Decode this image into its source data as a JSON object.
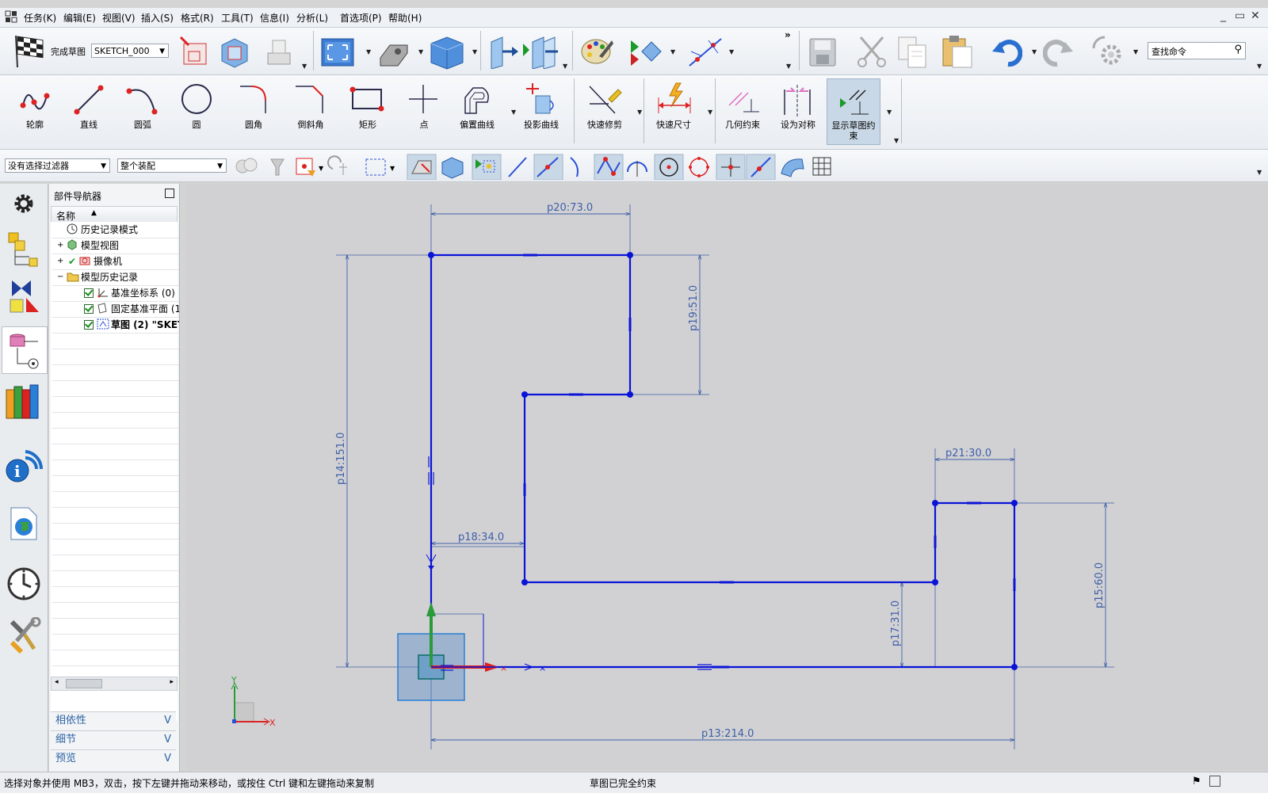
{
  "menu": {
    "items": [
      "任务(K)",
      "编辑(E)",
      "视图(V)",
      "插入(S)",
      "格式(R)",
      "工具(T)",
      "信息(I)",
      "分析(L)",
      "首选项(P)",
      "帮助(H)"
    ]
  },
  "toolbar_main": {
    "finish_sketch_label": "完成草图",
    "sketch_name": "SKETCH_000",
    "search_placeholder": "查找命令",
    "overflow_label": "»"
  },
  "sketch_tools": [
    {
      "label": "轮廓",
      "icon": "profile-icon"
    },
    {
      "label": "直线",
      "icon": "line-icon"
    },
    {
      "label": "圆弧",
      "icon": "arc-icon"
    },
    {
      "label": "圆",
      "icon": "circle-icon"
    },
    {
      "label": "圆角",
      "icon": "fillet-icon"
    },
    {
      "label": "倒斜角",
      "icon": "chamfer-icon"
    },
    {
      "label": "矩形",
      "icon": "rectangle-icon"
    },
    {
      "label": "点",
      "icon": "point-icon"
    },
    {
      "label": "偏置曲线",
      "icon": "offset-curve-icon"
    },
    {
      "label": "投影曲线",
      "icon": "project-curve-icon"
    },
    {
      "label": "快速修剪",
      "icon": "quick-trim-icon"
    },
    {
      "label": "快速尺寸",
      "icon": "rapid-dimension-icon"
    },
    {
      "label": "几何约束",
      "icon": "geometric-constraint-icon"
    },
    {
      "label": "设为对称",
      "icon": "make-symmetric-icon"
    },
    {
      "label": "显示草图约束",
      "icon": "show-constraints-icon"
    }
  ],
  "filters": {
    "selection_filter": "没有选择过滤器",
    "scope": "整个装配"
  },
  "navigator": {
    "title": "部件导航器",
    "column_header": "名称",
    "items": [
      {
        "label": "历史记录模式",
        "level": 0
      },
      {
        "label": "模型视图",
        "level": 0
      },
      {
        "label": "摄像机",
        "level": 0
      },
      {
        "label": "模型历史记录",
        "level": 0
      },
      {
        "label": "基准坐标系 (0)",
        "level": 1
      },
      {
        "label": "固定基准平面 (1",
        "level": 1
      },
      {
        "label": "草图 (2) \"SKET",
        "level": 1
      }
    ],
    "panels": [
      "相依性",
      "细节",
      "预览"
    ]
  },
  "dimensions": {
    "p13": "p13:214.0",
    "p14": "p14:151.0",
    "p15": "p15:60.0",
    "p17": "p17:31.0",
    "p18": "p18:34.0",
    "p19": "p19:51.0",
    "p20": "p20:73.0",
    "p21": "p21:30.0"
  },
  "triad": {
    "x": "X",
    "y": "Y"
  },
  "status": {
    "left": "选择对象并使用 MB3，双击，按下左键并拖动来移动，或按住 Ctrl 键和左键拖动来复制",
    "center": "草图已完全约束"
  },
  "colors": {
    "sketch": "#0a14d6",
    "dimension": "#3e5ea8",
    "canvas": "#d1d1d3"
  }
}
